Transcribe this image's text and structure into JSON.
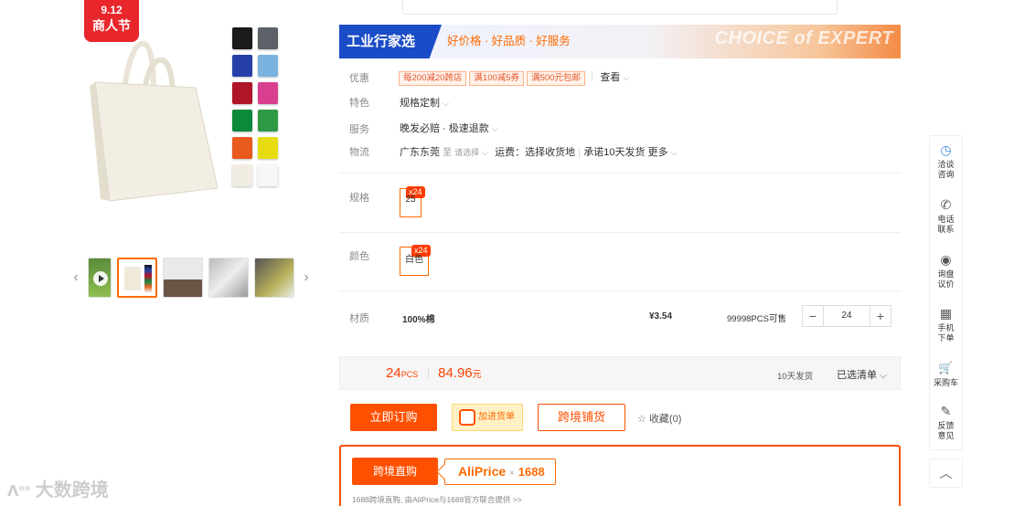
{
  "promo_badge": {
    "date": "9.12",
    "text": "商人节"
  },
  "swatch_colors": [
    "#1a1a1a",
    "#5b6166",
    "#2440a8",
    "#7ab3e0",
    "#b01428",
    "#d83f8e",
    "#0c8a3a",
    "#2f9a45",
    "#e85a1e",
    "#e8dc10",
    "#f1ece1",
    "#f7f7f7"
  ],
  "banner": {
    "label": "工业行家选",
    "subtitle": "好价格 · 好品质 · 好服务",
    "english": "CHOICE of EXPERT"
  },
  "rows": {
    "promo": {
      "label": "优惠",
      "tags": [
        "每200减20跨店",
        "满100减5券",
        "满500元包邮"
      ],
      "view": "查看"
    },
    "feature": {
      "label": "特色",
      "value": "规格定制"
    },
    "service": {
      "label": "服务",
      "value": "晚发必赔 · 极速退款"
    },
    "logistics": {
      "label": "物流",
      "origin": "广东东莞",
      "to": "至",
      "select": "请选择",
      "freight": "运费：选择收货地",
      "promise": "承诺10天发货",
      "more": "更多"
    }
  },
  "spec": {
    "label": "规格",
    "count": "x24",
    "value": "25"
  },
  "color": {
    "label": "颜色",
    "count": "x24",
    "value": "白色"
  },
  "material": {
    "label": "材质",
    "value": "100%棉",
    "price": "¥3.54",
    "stock": "99998PCS可售",
    "qty": "24"
  },
  "summary": {
    "qty": "24",
    "qty_unit": "PCS",
    "amount": "84.96",
    "amount_unit": "元",
    "ship": "10天发货",
    "selected": "已选清单"
  },
  "actions": {
    "buy": "立即订购",
    "add_cart": "加进货单",
    "cross": "跨境铺货",
    "fav": "收藏(0)"
  },
  "cross_border": {
    "direct": "跨境直购",
    "ali": "AliPrice",
    "times": "×",
    "partner": "1688",
    "note": "1688跨境直购, 由AliPrice与1688官方联合提供 >>"
  },
  "rail": [
    {
      "icon": "◷",
      "label1": "洽谈",
      "label2": "咨询"
    },
    {
      "icon": "✆",
      "label1": "电话",
      "label2": "联系"
    },
    {
      "icon": "◉",
      "label1": "询盘",
      "label2": "议价"
    },
    {
      "icon": "▦",
      "label1": "手机",
      "label2": "下单"
    },
    {
      "icon": "🛒",
      "label1": "采购车",
      "label2": ""
    },
    {
      "icon": "✎",
      "label1": "反馈",
      "label2": "意见"
    }
  ],
  "watermark": "大数跨境"
}
